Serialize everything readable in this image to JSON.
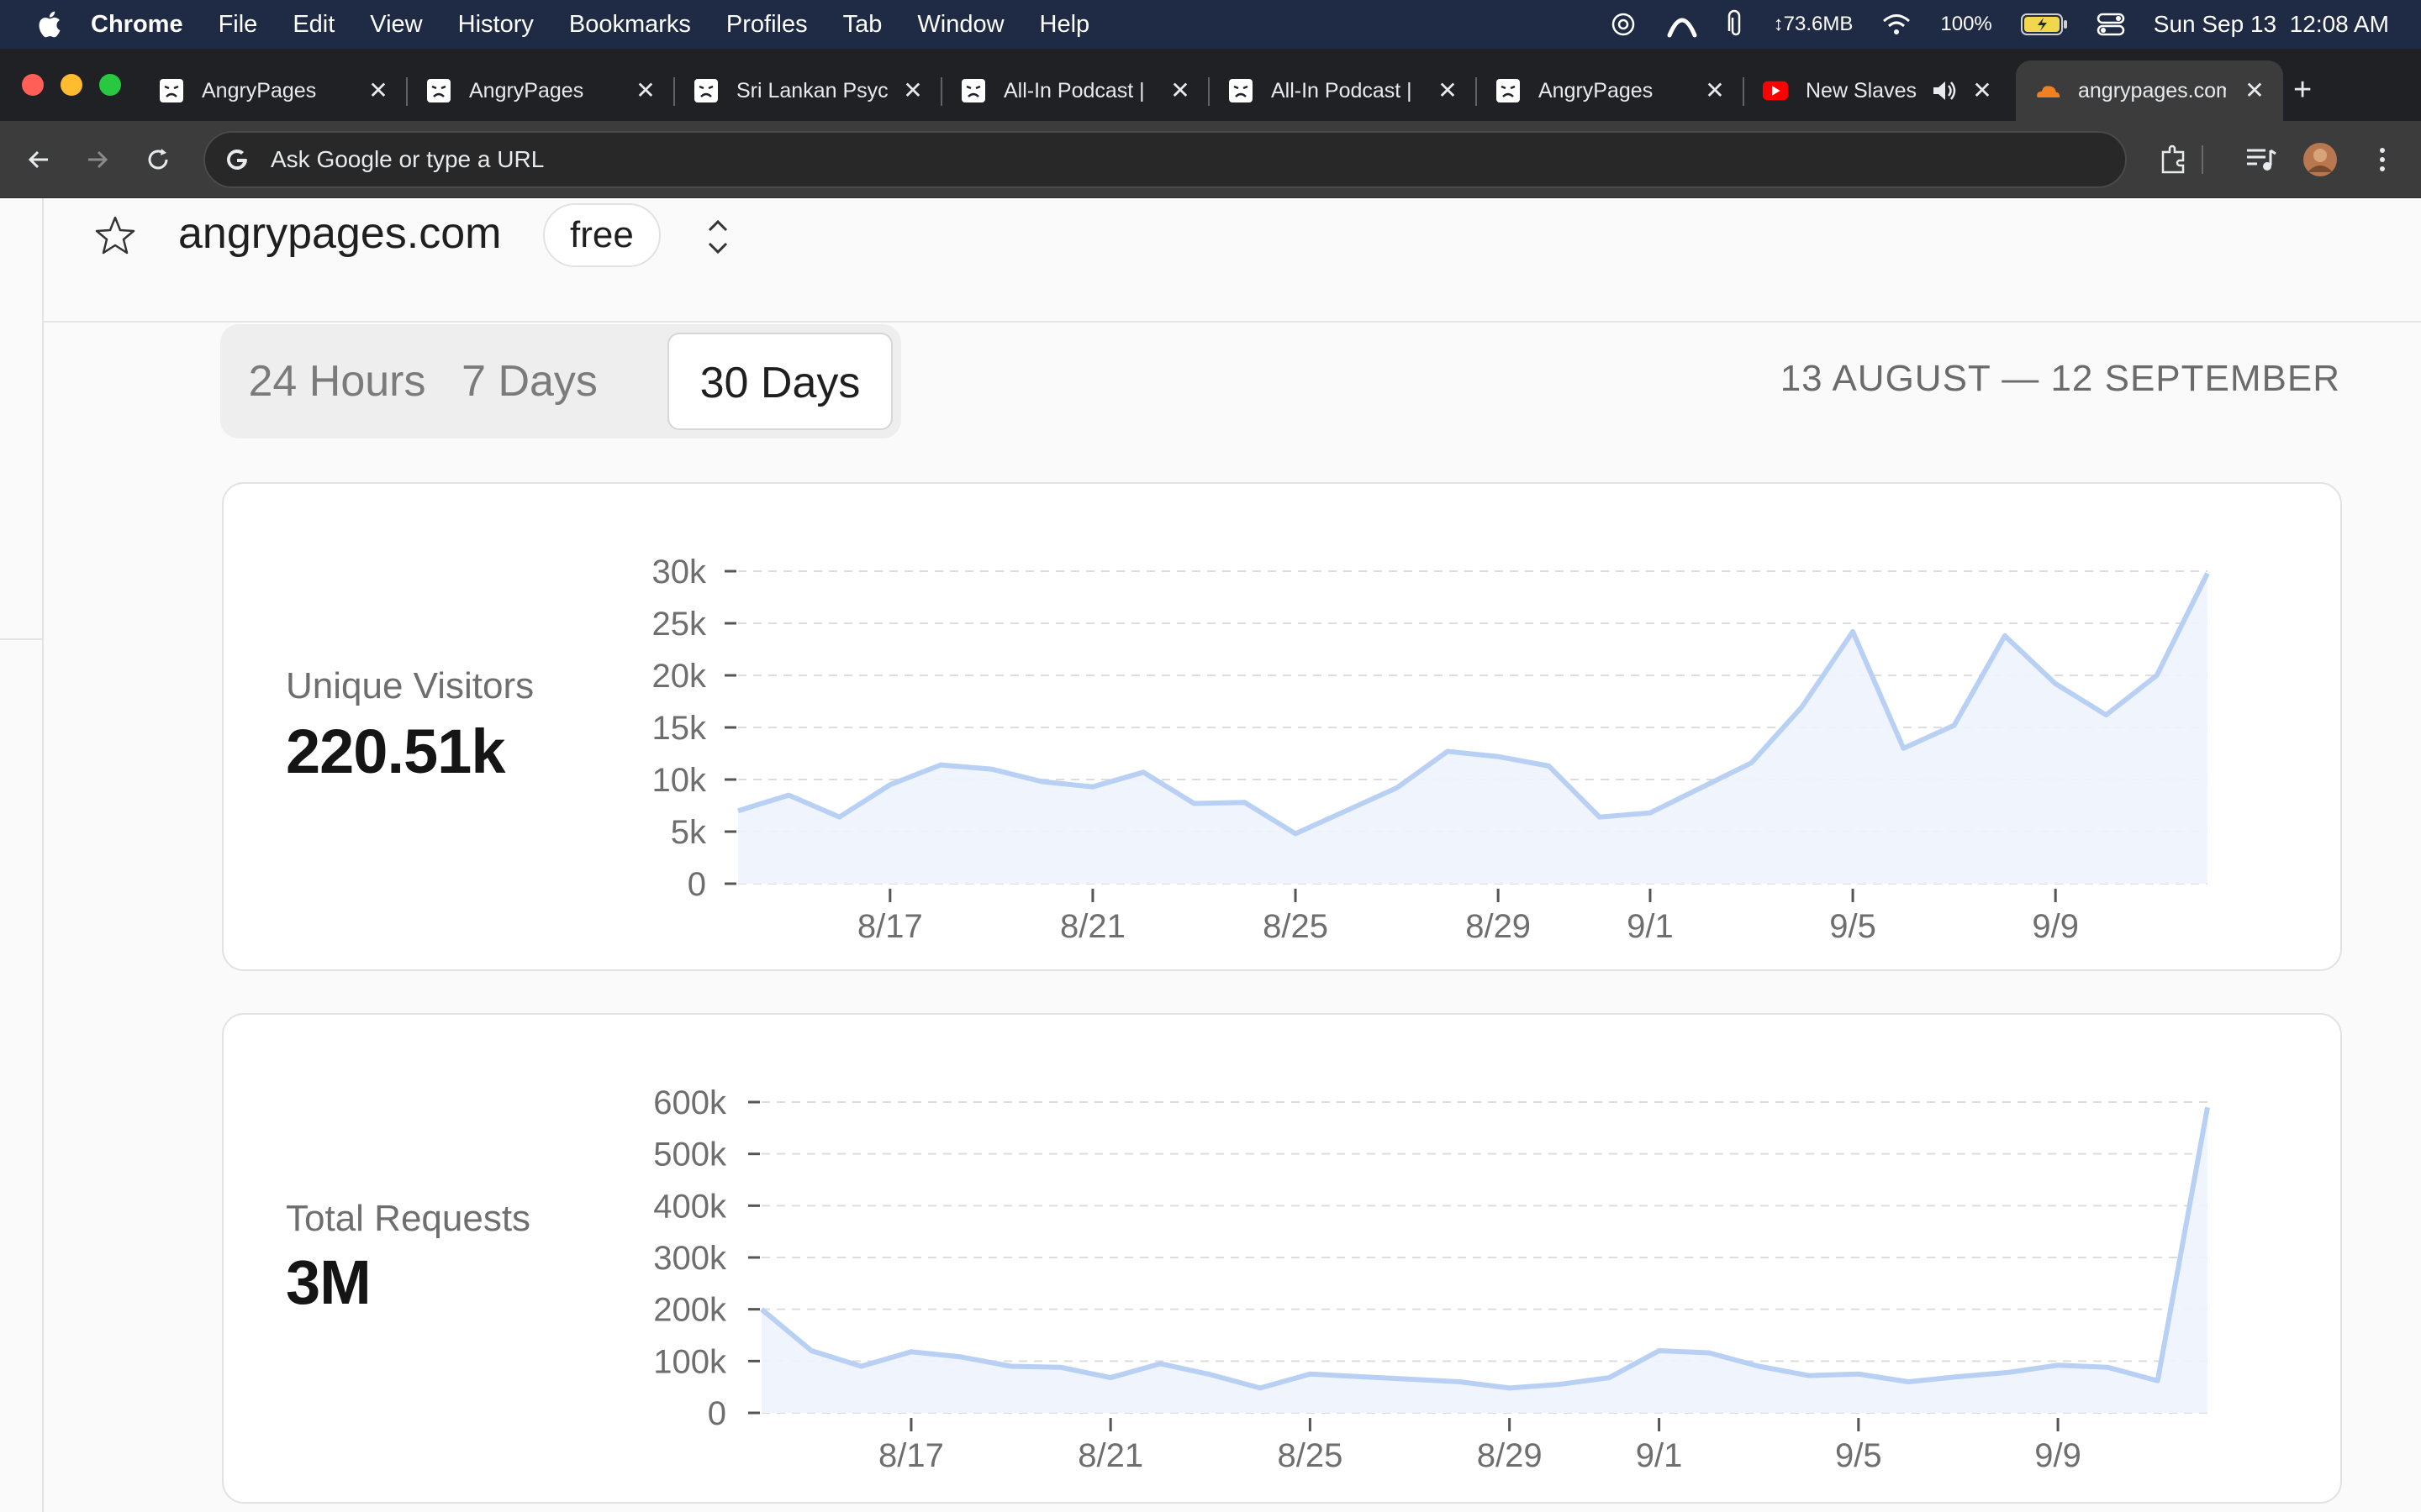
{
  "menubar": {
    "app": "Chrome",
    "items": [
      "File",
      "Edit",
      "View",
      "History",
      "Bookmarks",
      "Profiles",
      "Tab",
      "Window",
      "Help"
    ],
    "memory": "↕73.6MB",
    "battery": "100%",
    "clock": "Sun Sep 13  12:08 AM"
  },
  "tabs": [
    {
      "title": "AngryPages",
      "icon": "angrypages-favicon"
    },
    {
      "title": "AngryPages",
      "icon": "angrypages-favicon"
    },
    {
      "title": "Sri Lankan Psyc",
      "icon": "angrypages-favicon"
    },
    {
      "title": "All-In Podcast |",
      "icon": "angrypages-favicon"
    },
    {
      "title": "All-In Podcast |",
      "icon": "angrypages-favicon"
    },
    {
      "title": "AngryPages",
      "icon": "angrypages-favicon"
    },
    {
      "title": "New Slaves",
      "icon": "youtube-favicon"
    },
    {
      "title": "angrypages.com",
      "icon": "cloudflare-favicon"
    }
  ],
  "toolbar": {
    "omnibox_placeholder": "Ask Google or type a URL"
  },
  "site": {
    "name": "angrypages.com",
    "plan": "free"
  },
  "range": {
    "options": [
      "24 Hours",
      "7 Days",
      "30 Days"
    ],
    "selected": "30 Days",
    "dates": "13 AUGUST — 12 SEPTEMBER"
  },
  "cards": {
    "visitors": {
      "label": "Unique Visitors",
      "value": "220.51k"
    },
    "requests": {
      "label": "Total Requests",
      "value": "3M"
    }
  },
  "colors": {
    "line": "#b9d0f5",
    "fill": "#eef3fd",
    "grid": "#dddddd"
  },
  "chart_data": [
    {
      "type": "area",
      "title": "",
      "x": [
        "8/14",
        "8/15",
        "8/16",
        "8/17",
        "8/18",
        "8/19",
        "8/20",
        "8/21",
        "8/22",
        "8/23",
        "8/24",
        "8/25",
        "8/26",
        "8/27",
        "8/28",
        "8/29",
        "8/30",
        "8/31",
        "9/1",
        "9/2",
        "9/3",
        "9/4",
        "9/5",
        "9/6",
        "9/7",
        "9/8",
        "9/9",
        "9/10",
        "9/11",
        "9/12"
      ],
      "values": [
        7000,
        8500,
        6400,
        9500,
        11400,
        11000,
        9800,
        9300,
        10700,
        7700,
        7800,
        4800,
        7000,
        9200,
        12700,
        12200,
        11300,
        6400,
        6800,
        9200,
        11600,
        17000,
        24200,
        13000,
        15200,
        23800,
        19200,
        16200,
        20000,
        29800
      ],
      "xticks": [
        "8/17",
        "8/21",
        "8/25",
        "8/29",
        "9/1",
        "9/5",
        "9/9"
      ],
      "yticks": [
        "0",
        "5k",
        "10k",
        "15k",
        "20k",
        "25k",
        "30k"
      ],
      "ylim": [
        0,
        30000
      ],
      "grid": true
    },
    {
      "type": "area",
      "title": "",
      "x": [
        "8/14",
        "8/15",
        "8/16",
        "8/17",
        "8/18",
        "8/19",
        "8/20",
        "8/21",
        "8/22",
        "8/23",
        "8/24",
        "8/25",
        "8/26",
        "8/27",
        "8/28",
        "8/29",
        "8/30",
        "8/31",
        "9/1",
        "9/2",
        "9/3",
        "9/4",
        "9/5",
        "9/6",
        "9/7",
        "9/8",
        "9/9",
        "9/10",
        "9/11",
        "9/12"
      ],
      "values": [
        200000,
        120000,
        90000,
        118000,
        108000,
        90000,
        88000,
        68000,
        95000,
        74000,
        48000,
        75000,
        70000,
        65000,
        60000,
        48000,
        55000,
        68000,
        120000,
        116000,
        90000,
        72000,
        75000,
        60000,
        70000,
        78000,
        92000,
        88000,
        62000,
        590000
      ],
      "xticks": [
        "8/17",
        "8/21",
        "8/25",
        "8/29",
        "9/1",
        "9/5",
        "9/9"
      ],
      "yticks": [
        "0",
        "100k",
        "200k",
        "300k",
        "400k",
        "500k",
        "600k"
      ],
      "ylim": [
        0,
        600000
      ],
      "grid": true
    }
  ]
}
